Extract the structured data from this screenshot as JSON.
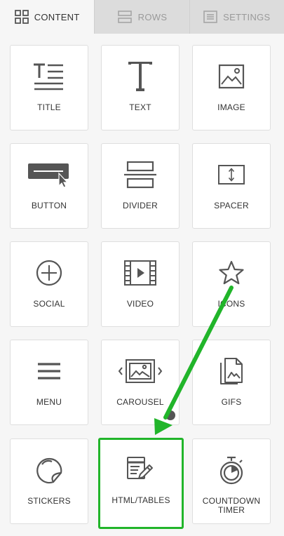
{
  "tabs": [
    {
      "label": "CONTENT",
      "icon": "grid-icon",
      "active": true
    },
    {
      "label": "ROWS",
      "icon": "rows-icon",
      "active": false
    },
    {
      "label": "SETTINGS",
      "icon": "settings-list-icon",
      "active": false
    }
  ],
  "blocks": [
    {
      "label": "TITLE",
      "icon": "title-icon"
    },
    {
      "label": "TEXT",
      "icon": "text-icon"
    },
    {
      "label": "IMAGE",
      "icon": "image-icon"
    },
    {
      "label": "BUTTON",
      "icon": "button-icon"
    },
    {
      "label": "DIVIDER",
      "icon": "divider-icon"
    },
    {
      "label": "SPACER",
      "icon": "spacer-icon"
    },
    {
      "label": "SOCIAL",
      "icon": "social-plus-icon"
    },
    {
      "label": "VIDEO",
      "icon": "video-icon"
    },
    {
      "label": "ICONS",
      "icon": "star-icon"
    },
    {
      "label": "MENU",
      "icon": "menu-icon"
    },
    {
      "label": "CAROUSEL",
      "icon": "carousel-icon"
    },
    {
      "label": "GIFS",
      "icon": "gifs-icon"
    },
    {
      "label": "STICKERS",
      "icon": "sticker-icon"
    },
    {
      "label": "HTML/TABLES",
      "icon": "html-tables-icon",
      "highlighted": true
    },
    {
      "label": "COUNTDOWN\nTIMER",
      "icon": "stopwatch-icon"
    }
  ],
  "colors": {
    "highlight": "#21b52a",
    "tab_active_bg": "#f6f6f6",
    "tab_inactive_bg": "#dcdcdc",
    "icon": "#555555"
  }
}
